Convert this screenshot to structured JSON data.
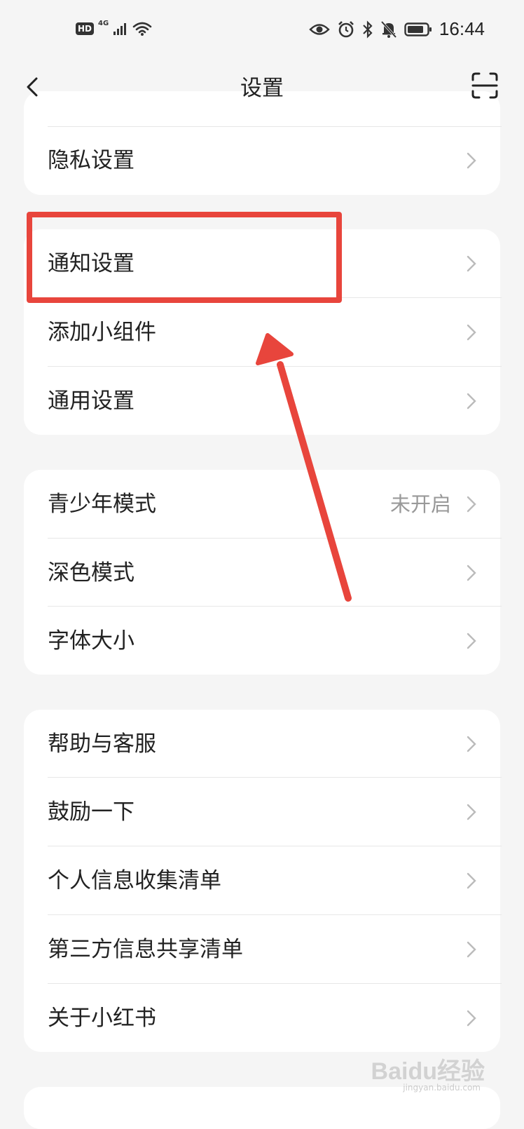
{
  "status_bar": {
    "hd": "HD",
    "network": "4G",
    "time": "16:44"
  },
  "header": {
    "title": "设置"
  },
  "cards": [
    {
      "items": [
        {
          "label": "隐私设置"
        }
      ]
    },
    {
      "items": [
        {
          "label": "通知设置"
        },
        {
          "label": "添加小组件"
        },
        {
          "label": "通用设置"
        }
      ]
    },
    {
      "items": [
        {
          "label": "青少年模式",
          "value": "未开启"
        },
        {
          "label": "深色模式"
        },
        {
          "label": "字体大小"
        }
      ]
    },
    {
      "items": [
        {
          "label": "帮助与客服"
        },
        {
          "label": "鼓励一下"
        },
        {
          "label": "个人信息收集清单"
        },
        {
          "label": "第三方信息共享清单"
        },
        {
          "label": "关于小红书"
        }
      ]
    }
  ],
  "watermark": {
    "text": "Baidu经验",
    "url": "jingyan.baidu.com"
  },
  "colors": {
    "background": "#f5f5f5",
    "card": "#ffffff",
    "annotation": "#e8453c",
    "value_text": "#999999"
  }
}
